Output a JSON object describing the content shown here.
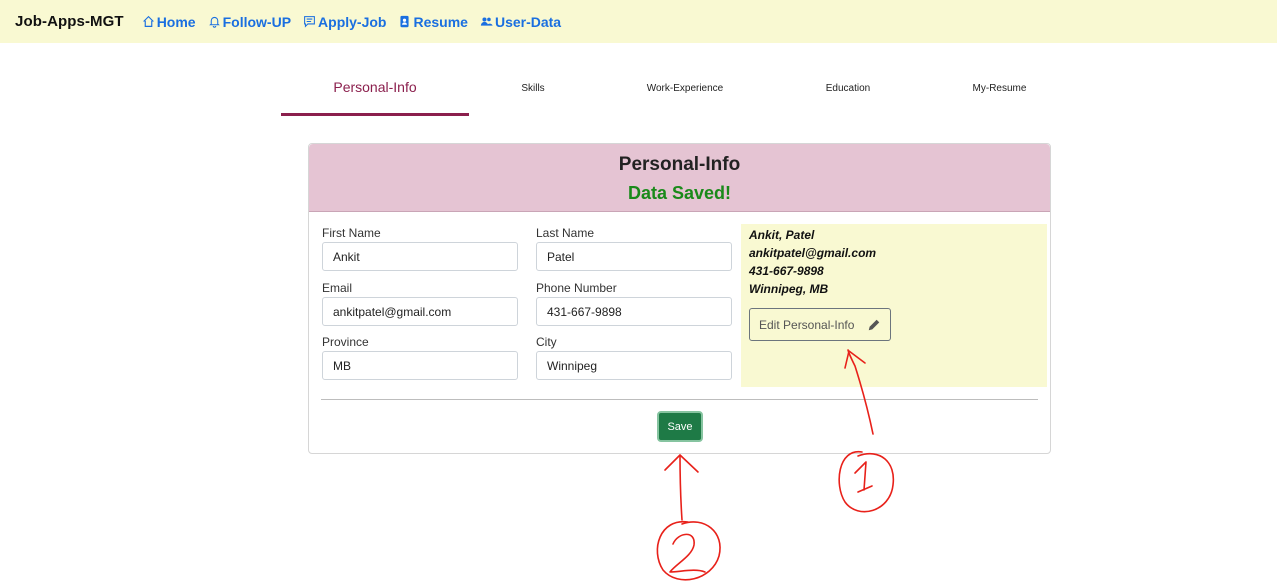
{
  "navbar": {
    "brand": "Job-Apps-MGT",
    "links": [
      {
        "label": "Home",
        "icon": "home-icon"
      },
      {
        "label": "Follow-UP",
        "icon": "bell-icon"
      },
      {
        "label": "Apply-Job",
        "icon": "message-icon"
      },
      {
        "label": "Resume",
        "icon": "badge-icon"
      },
      {
        "label": "User-Data",
        "icon": "users-icon"
      }
    ]
  },
  "tabs": [
    {
      "label": "Personal-Info",
      "active": true
    },
    {
      "label": "Skills"
    },
    {
      "label": "Work-Experience"
    },
    {
      "label": "Education"
    },
    {
      "label": "My-Resume"
    }
  ],
  "card": {
    "title": "Personal-Info",
    "status": "Data Saved!",
    "fields": {
      "first_name": {
        "label": "First Name",
        "value": "Ankit"
      },
      "last_name": {
        "label": "Last Name",
        "value": "Patel"
      },
      "email": {
        "label": "Email",
        "value": "ankitpatel@gmail.com"
      },
      "phone": {
        "label": "Phone Number",
        "value": "431-667-9898"
      },
      "province": {
        "label": "Province",
        "value": "MB"
      },
      "city": {
        "label": "City",
        "value": "Winnipeg"
      }
    },
    "summary": {
      "name": "Ankit, Patel",
      "email": "ankitpatel@gmail.com",
      "phone": "431-667-9898",
      "location": "Winnipeg, MB",
      "edit_label": "Edit Personal-Info"
    },
    "save_label": "Save"
  },
  "colors": {
    "navbar_bg": "#f9f9d2",
    "accent": "#8b1f4d",
    "header_bg": "#e5c4d3",
    "status_green": "#1a8a1a",
    "save_green": "#1e7a46",
    "link_blue": "#1a6fe0",
    "annotation_red": "#e8211a"
  }
}
